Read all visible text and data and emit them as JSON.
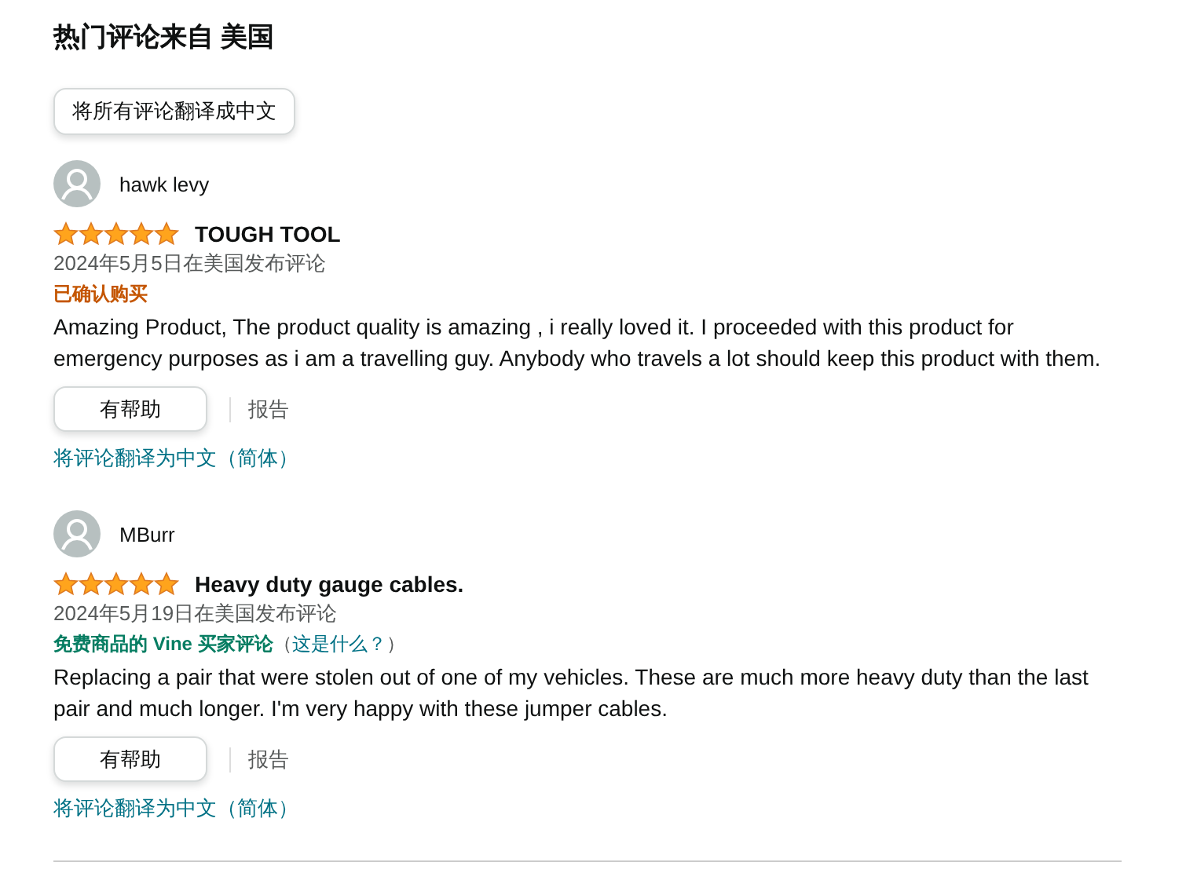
{
  "heading": "热门评论来自 美国",
  "translate_all_button": "将所有评论翻译成中文",
  "reviews": [
    {
      "author": "hawk levy",
      "stars": 5,
      "title": "TOUGH TOOL",
      "date": "2024年5月5日在美国发布评论",
      "badge": {
        "kind": "verified",
        "label": "已确认购买"
      },
      "body": "Amazing Product, The product quality is amazing , i really loved it. I proceeded with this product for emergency purposes as i am a travelling guy. Anybody who travels a lot should keep this product with them.",
      "helpful_button": "有帮助",
      "report_link": "报告",
      "translate_link": "将评论翻译为中文（简体）"
    },
    {
      "author": "MBurr",
      "stars": 5,
      "title": "Heavy duty gauge cables.",
      "date": "2024年5月19日在美国发布评论",
      "badge": {
        "kind": "vine",
        "label": "免费商品的 Vine 买家评论",
        "open_paren": "（",
        "link": "这是什么？",
        "close_paren": "）"
      },
      "body": "Replacing a pair that were stolen out of one of my vehicles. These are much more heavy duty than the last pair and much longer. I'm very happy with these jumper cables.",
      "helpful_button": "有帮助",
      "report_link": "报告",
      "translate_link": "将评论翻译为中文（简体）"
    }
  ]
}
